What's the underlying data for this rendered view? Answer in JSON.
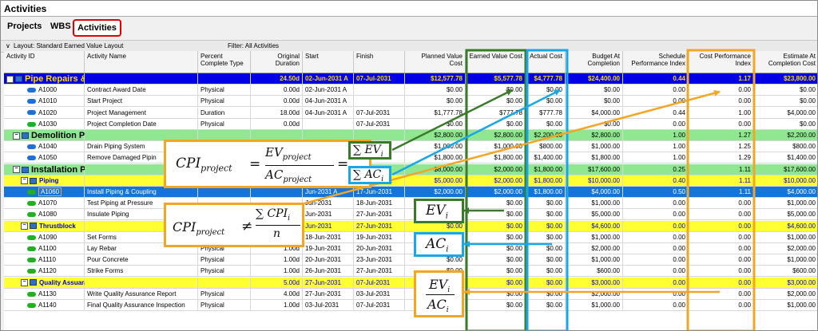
{
  "window": {
    "title": "Activities"
  },
  "tabs": [
    {
      "label": "Projects"
    },
    {
      "label": "WBS"
    },
    {
      "label": "Activities"
    }
  ],
  "layout_bar": {
    "layout": "Layout: Standard Earned Value Layout",
    "filter": "Filter: All Activities"
  },
  "columns": [
    {
      "label": "Activity ID"
    },
    {
      "label": "Activity Name"
    },
    {
      "label": "Percent Complete Type"
    },
    {
      "label": "Original Duration"
    },
    {
      "label": "Start"
    },
    {
      "label": "Finish"
    },
    {
      "label": "Planned Value Cost"
    },
    {
      "label": "Earned Value Cost"
    },
    {
      "label": "Actual Cost"
    },
    {
      "label": "Budget At Completion"
    },
    {
      "label": "Schedule Performance Index"
    },
    {
      "label": "Cost Performance Index"
    },
    {
      "label": "Estimate At Completion Cost"
    }
  ],
  "rows": [
    {
      "kind": "wbs1",
      "id": "Pipe Repairs & Improvement",
      "name": "",
      "type": "",
      "dur": "24.50d",
      "start": "02-Jun-2031 A",
      "finish": "07-Jul-2031",
      "pv": "$12,577.78",
      "ev": "$5,577.78",
      "ac": "$4,777.78",
      "bac": "$24,400.00",
      "spi": "0.44",
      "cpi": "1.17",
      "eac": "$23,800.00"
    },
    {
      "kind": "act",
      "icon": "blue",
      "id": "A1000",
      "name": "Contract Award Date",
      "type": "Physical",
      "dur": "0.00d",
      "start": "02-Jun-2031 A",
      "finish": "",
      "pv": "$0.00",
      "ev": "$0.00",
      "ac": "$0.00",
      "bac": "$0.00",
      "spi": "0.00",
      "cpi": "0.00",
      "eac": "$0.00"
    },
    {
      "kind": "act",
      "icon": "blue",
      "id": "A1010",
      "name": "Start Project",
      "type": "Physical",
      "dur": "0.00d",
      "start": "04-Jun-2031 A",
      "finish": "",
      "pv": "$0.00",
      "ev": "$0.00",
      "ac": "$0.00",
      "bac": "$0.00",
      "spi": "0.00",
      "cpi": "0.00",
      "eac": "$0.00"
    },
    {
      "kind": "act",
      "icon": "blue",
      "id": "A1020",
      "name": "Project Management",
      "type": "Duration",
      "dur": "18.00d",
      "start": "04-Jun-2031 A",
      "finish": "07-Jul-2031",
      "pv": "$1,777.78",
      "ev": "$777.78",
      "ac": "$777.78",
      "bac": "$4,000.00",
      "spi": "0.44",
      "cpi": "1.00",
      "eac": "$4,000.00"
    },
    {
      "kind": "act",
      "icon": "green",
      "id": "A1030",
      "name": "Project Completion Date",
      "type": "Physical",
      "dur": "0.00d",
      "start": "",
      "finish": "07-Jul-2031",
      "pv": "$0.00",
      "ev": "$0.00",
      "ac": "$0.00",
      "bac": "$0.00",
      "spi": "0.00",
      "cpi": "0.00",
      "eac": "$0.00"
    },
    {
      "kind": "wbs2",
      "id": "Demolition Piping",
      "name": "",
      "type": "",
      "dur": "",
      "start": "",
      "finish": "",
      "pv": "$2,800.00",
      "ev": "$2,800.00",
      "ac": "$2,200.00",
      "bac": "$2,800.00",
      "spi": "1.00",
      "cpi": "1.27",
      "eac": "$2,200.00"
    },
    {
      "kind": "act",
      "icon": "blue",
      "id": "A1040",
      "name": "Drain Piping System",
      "type": "",
      "dur": "",
      "start": "",
      "finish": "",
      "pv": "$1,000.00",
      "ev": "$1,000.00",
      "ac": "$800.00",
      "bac": "$1,000.00",
      "spi": "1.00",
      "cpi": "1.25",
      "eac": "$800.00"
    },
    {
      "kind": "act",
      "icon": "blue",
      "id": "A1050",
      "name": "Remove Damaged Pipin",
      "type": "",
      "dur": "",
      "start": "",
      "finish": "",
      "pv": "$1,800.00",
      "ev": "$1,800.00",
      "ac": "$1,400.00",
      "bac": "$1,800.00",
      "spi": "1.00",
      "cpi": "1.29",
      "eac": "$1,400.00"
    },
    {
      "kind": "wbs2",
      "id": "Installation Piping System",
      "name": "",
      "type": "",
      "dur": "",
      "start": "",
      "finish": "",
      "pv": "$8,000.00",
      "ev": "$2,000.00",
      "ac": "$1,800.00",
      "bac": "$17,600.00",
      "spi": "0.25",
      "cpi": "1.11",
      "eac": "$17,600.00"
    },
    {
      "kind": "wbs3",
      "id": "Piping",
      "name": "",
      "type": "",
      "dur": "15.50d",
      "start": "09-Jun-2031 A",
      "finish": "27-Jun-2031",
      "pv": "$5,000.00",
      "ev": "$2,000.00",
      "ac": "$1,800.00",
      "bac": "$10,000.00",
      "spi": "0.40",
      "cpi": "1.11",
      "eac": "$10,000.00"
    },
    {
      "kind": "sel",
      "icon": "green",
      "id": "A1060",
      "name": "Install Piping & Coupling",
      "type": "",
      "dur": "",
      "start": "Jun-2031 A",
      "finish": "17-Jun-2031",
      "pv": "$2,000.00",
      "ev": "$2,000.00",
      "ac": "$1,800.00",
      "bac": "$4,000.00",
      "spi": "0.50",
      "cpi": "1.11",
      "eac": "$4,000.00"
    },
    {
      "kind": "act",
      "icon": "green",
      "id": "A1070",
      "name": "Test Piping at Pressure",
      "type": "",
      "dur": "",
      "start": "Jun-2031",
      "finish": "18-Jun-2031",
      "pv": "$0.00",
      "ev": "$0.00",
      "ac": "$0.00",
      "bac": "$1,000.00",
      "spi": "0.00",
      "cpi": "0.00",
      "eac": "$1,000.00"
    },
    {
      "kind": "act",
      "icon": "green",
      "id": "A1080",
      "name": "Insulate Piping",
      "type": "",
      "dur": "",
      "start": "Jun-2031",
      "finish": "27-Jun-2031",
      "pv": "$0.00",
      "ev": "$0.00",
      "ac": "$0.00",
      "bac": "$5,000.00",
      "spi": "0.00",
      "cpi": "0.00",
      "eac": "$5,000.00"
    },
    {
      "kind": "wbs3",
      "id": "Thrustblock",
      "name": "",
      "type": "",
      "dur": "",
      "start": "Jun-2031",
      "finish": "27-Jun-2031",
      "pv": "$0.00",
      "ev": "$0.00",
      "ac": "$0.00",
      "bac": "$4,600.00",
      "spi": "0.00",
      "cpi": "0.00",
      "eac": "$4,600.00"
    },
    {
      "kind": "act",
      "icon": "green",
      "id": "A1090",
      "name": "Set Forms",
      "type": "Physical",
      "dur": "1.00d",
      "start": "18-Jun-2031",
      "finish": "19-Jun-2031",
      "pv": "$0.00",
      "ev": "$0.00",
      "ac": "$0.00",
      "bac": "$1,000.00",
      "spi": "0.00",
      "cpi": "0.00",
      "eac": "$1,000.00"
    },
    {
      "kind": "act",
      "icon": "green",
      "id": "A1100",
      "name": "Lay Rebar",
      "type": "Physical",
      "dur": "1.00d",
      "start": "19-Jun-2031",
      "finish": "20-Jun-2031",
      "pv": "$0.00",
      "ev": "$0.00",
      "ac": "$0.00",
      "bac": "$2,000.00",
      "spi": "0.00",
      "cpi": "0.00",
      "eac": "$2,000.00"
    },
    {
      "kind": "act",
      "icon": "green",
      "id": "A1110",
      "name": "Pour Concrete",
      "type": "Physical",
      "dur": "1.00d",
      "start": "20-Jun-2031",
      "finish": "23-Jun-2031",
      "pv": "$0.00",
      "ev": "$0.00",
      "ac": "$0.00",
      "bac": "$1,000.00",
      "spi": "0.00",
      "cpi": "0.00",
      "eac": "$1,000.00"
    },
    {
      "kind": "act",
      "icon": "green",
      "id": "A1120",
      "name": "Strike Forms",
      "type": "Physical",
      "dur": "1.00d",
      "start": "26-Jun-2031",
      "finish": "27-Jun-2031",
      "pv": "$0.00",
      "ev": "$0.00",
      "ac": "$0.00",
      "bac": "$600.00",
      "spi": "0.00",
      "cpi": "0.00",
      "eac": "$600.00"
    },
    {
      "kind": "wbs3",
      "id": "Quality Assuarance",
      "name": "",
      "type": "",
      "dur": "5.00d",
      "start": "27-Jun-2031",
      "finish": "07-Jul-2031",
      "pv": "$0.00",
      "ev": "$0.00",
      "ac": "$0.00",
      "bac": "$3,000.00",
      "spi": "0.00",
      "cpi": "0.00",
      "eac": "$3,000.00"
    },
    {
      "kind": "act",
      "icon": "green",
      "id": "A1130",
      "name": "Write Quality Assurance Report",
      "type": "Physical",
      "dur": "4.00d",
      "start": "27-Jun-2031",
      "finish": "03-Jul-2031",
      "pv": "$0.00",
      "ev": "$0.00",
      "ac": "$0.00",
      "bac": "$2,000.00",
      "spi": "0.00",
      "cpi": "0.00",
      "eac": "$2,000.00"
    },
    {
      "kind": "act",
      "icon": "green",
      "id": "A1140",
      "name": "Final Quality Assurance Inspection",
      "type": "Physical",
      "dur": "1.00d",
      "start": "03-Jul-2031",
      "finish": "07-Jul-2031",
      "pv": "$0.00",
      "ev": "$0.00",
      "ac": "$0.00",
      "bac": "$1,000.00",
      "spi": "0.00",
      "cpi": "0.00",
      "eac": "$1,000.00"
    }
  ],
  "annotations": {
    "cpi_project": {
      "lhs_base": "CPI",
      "lhs_sub": "project",
      "ev": "EV",
      "ev_sub": "project",
      "ac": "AC",
      "ac_sub": "project",
      "sum_ev": "∑ EV",
      "sum_ev_sub": "i",
      "sum_ac": "∑ AC",
      "sum_ac_sub": "i"
    },
    "cpi_neq": {
      "lhs_base": "CPI",
      "lhs_sub": "project",
      "neq": "≠",
      "num": "∑ CPI",
      "num_sub": "i",
      "den": "n"
    },
    "ev_i": {
      "base": "EV",
      "sub": "i"
    },
    "ac_i": {
      "base": "AC",
      "sub": "i"
    },
    "ratio": {
      "num": "EV",
      "num_sub": "i",
      "den": "AC",
      "den_sub": "i"
    },
    "colors": {
      "green": "#3a7a2a",
      "blue": "#1aa7e6",
      "orange": "#f2a623",
      "red": "#e00000"
    }
  }
}
